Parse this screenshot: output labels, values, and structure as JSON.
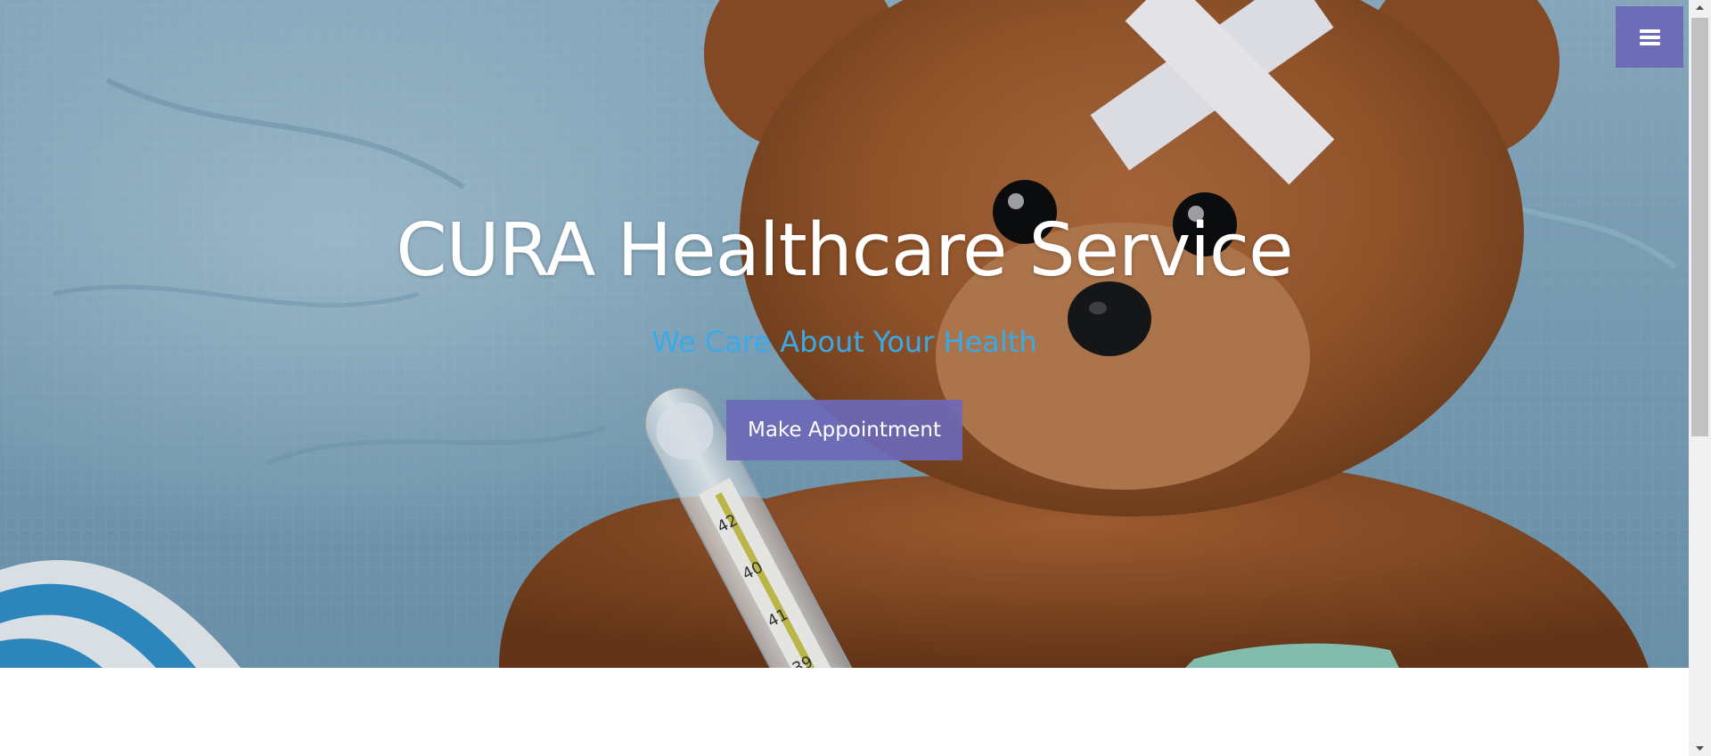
{
  "hero": {
    "title": "CURA Healthcare Service",
    "subtitle": "We Care About Your Health",
    "cta_label": "Make Appointment",
    "background_image": "teddy-bear-with-bandage-and-thermometer"
  },
  "nav": {
    "menu_icon": "hamburger-menu-icon"
  },
  "colors": {
    "accent": "#6c68b7",
    "subtitle": "#3ba9e8",
    "title": "#ffffff"
  }
}
